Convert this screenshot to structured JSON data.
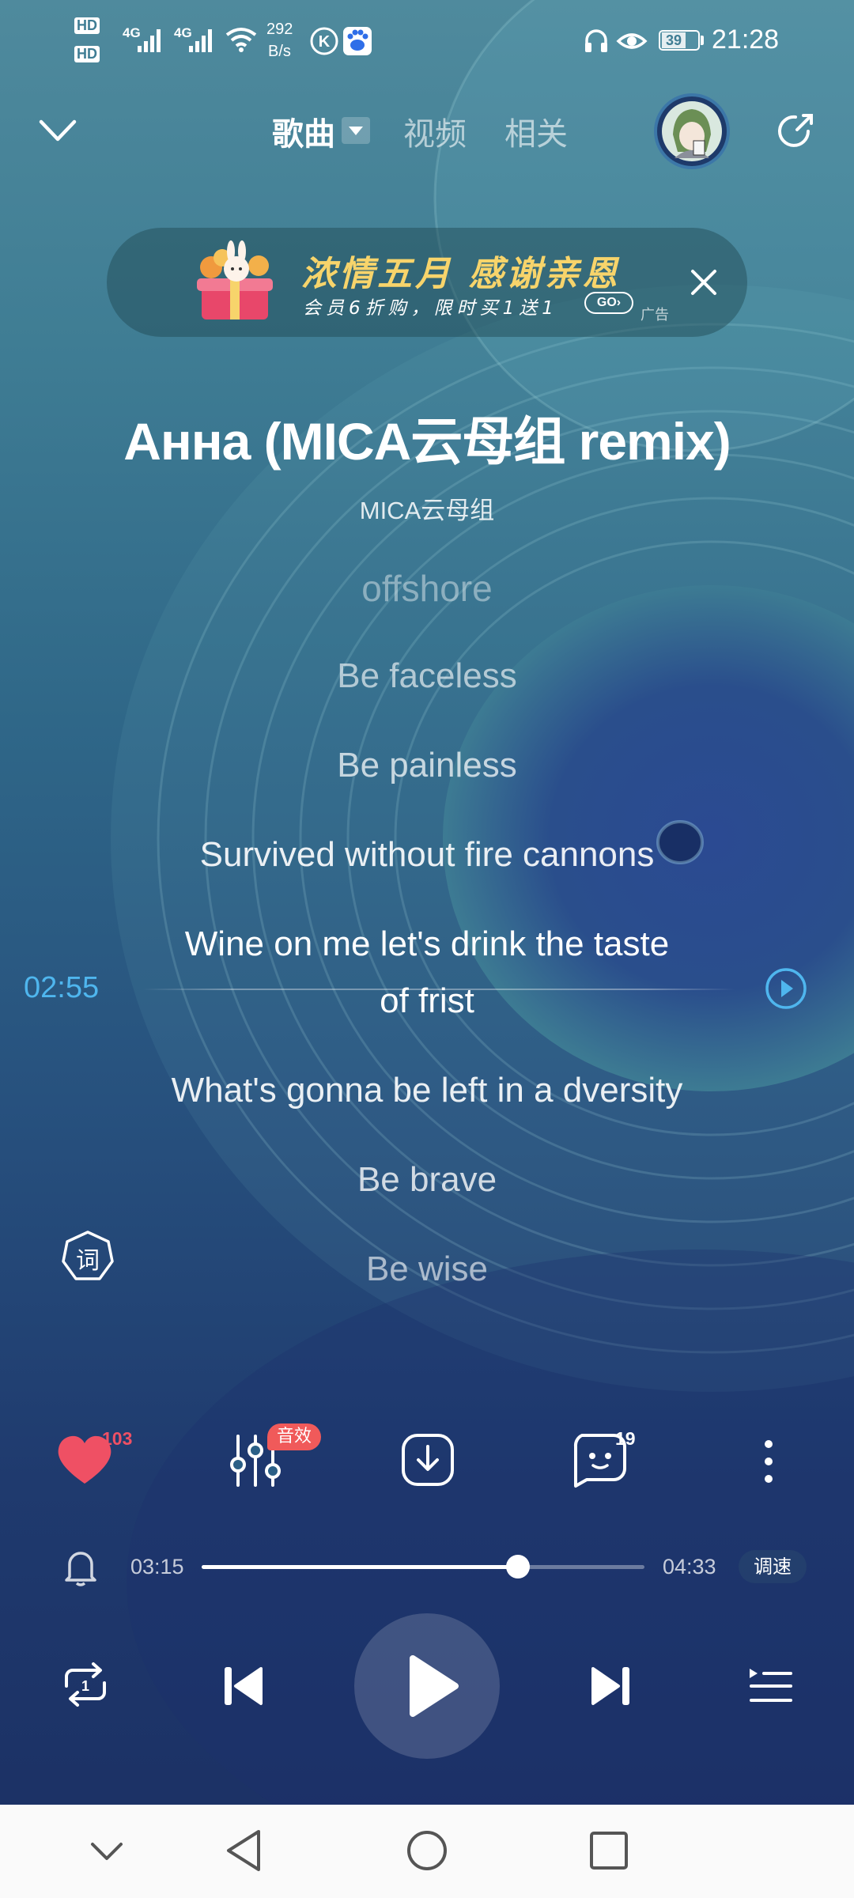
{
  "status_bar": {
    "sim1": "HD",
    "sim2": "HD",
    "net1": "4G",
    "net2": "4G",
    "speed_value": "292",
    "speed_unit": "B/s",
    "battery": "39",
    "time": "21:28"
  },
  "top_nav": {
    "tabs": [
      {
        "label": "歌曲",
        "active": true
      },
      {
        "label": "视频",
        "active": false
      },
      {
        "label": "相关",
        "active": false
      }
    ]
  },
  "ad_banner": {
    "title": "浓情五月 感谢亲恩",
    "subtitle": "会员6折购，限时买1送1",
    "go_label": "GO",
    "ad_tag": "广告"
  },
  "song": {
    "title": "Анна (MICA云母组 remix)",
    "artist": "MICA云母组"
  },
  "lyrics": {
    "lines": [
      "offshore",
      "Be faceless",
      "Be painless",
      "Survived without fire cannons",
      "Wine on me let's drink the taste",
      "of frist",
      "What's gonna be left in a dversity",
      "Be brave",
      "Be wise"
    ],
    "seek_time": "02:55",
    "lyric_button": "词"
  },
  "actions": {
    "like_count": "103",
    "effects_badge": "音效",
    "comment_count": "19"
  },
  "progress": {
    "current": "03:15",
    "total": "04:33",
    "fraction": 0.714,
    "speed_label": "调速"
  },
  "colors": {
    "accent_blue": "#4fb6ee",
    "like_red": "#ef5064",
    "badge_red": "#f05a5a",
    "ad_gold": "#f7d46b"
  },
  "icons": [
    "back-chevron-icon",
    "share-icon",
    "close-icon",
    "lyric-icon",
    "heart-icon",
    "equalizer-icon",
    "download-icon",
    "comment-icon",
    "more-icon",
    "bell-icon",
    "repeat-icon",
    "previous-icon",
    "play-icon",
    "next-icon",
    "playlist-icon",
    "nav-back-icon",
    "nav-home-icon",
    "nav-recents-icon",
    "nav-collapse-icon"
  ]
}
